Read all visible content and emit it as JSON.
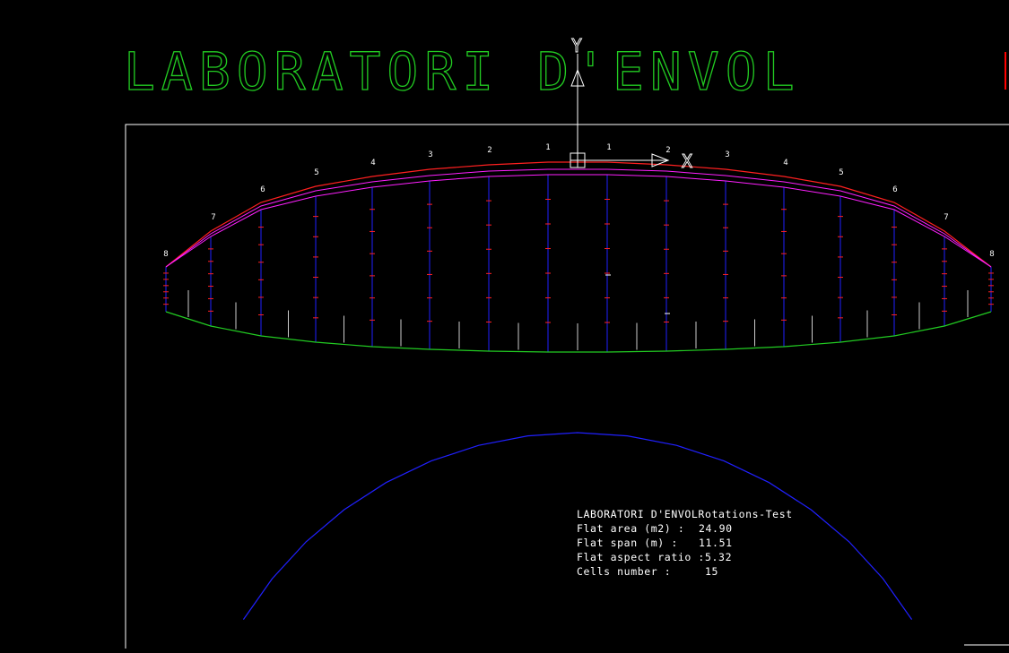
{
  "drawing": {
    "title": "LABORATORI D'ENVOL",
    "axes": {
      "y_label": "Y",
      "x_label": "X"
    },
    "cell_numbers_left": [
      "8",
      "7",
      "6",
      "5",
      "4",
      "3",
      "2",
      "1"
    ],
    "cell_numbers_right": [
      "1",
      "2",
      "3",
      "4",
      "5",
      "6",
      "7",
      "8"
    ],
    "info": {
      "header": "LABORATORI D'ENVOLRotations-Test",
      "flat_area_label": "Flat area (m2) :",
      "flat_area_value": "24.90",
      "flat_span_label": "Flat span (m) :",
      "flat_span_value": "11.51",
      "flat_ar_label": "Flat aspect ratio :",
      "flat_ar_value": "5.32",
      "cells_label": "Cells number :",
      "cells_value": "15"
    },
    "colors": {
      "title": "#22cc22",
      "frame": "#ffffff",
      "leading_edge": "#ff2020",
      "profile": "#ff20ff",
      "ribs": "#2020ff",
      "rib_ticks": "#ff2020",
      "trailing_edge": "#22cc22",
      "arc": "#2020ff",
      "axis": "#ffffff",
      "accent_red": "#ff0000"
    }
  }
}
